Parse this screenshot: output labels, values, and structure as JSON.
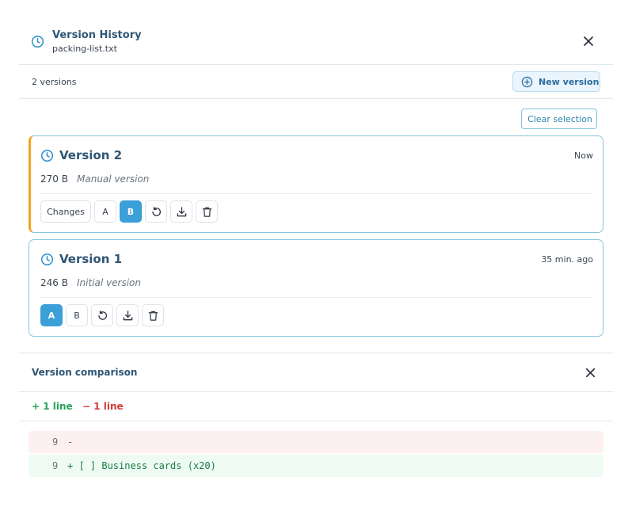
{
  "header": {
    "title": "Version History",
    "filename": "packing-list.txt",
    "accent": "#2f8fcf"
  },
  "toolbar": {
    "count_label": "2 versions",
    "new_version_label": "New version"
  },
  "clear_selection_label": "Clear selection",
  "versions": [
    {
      "title": "Version 2",
      "time": "Now",
      "size": "270 B",
      "note": "Manual version",
      "changes_label": "Changes",
      "compare_a_label": "A",
      "compare_b_label": "B",
      "selected_slot": "B",
      "is_current": true,
      "current_color": "#f0a51c"
    },
    {
      "title": "Version 1",
      "time": "35 min. ago",
      "size": "246 B",
      "note": "Initial version",
      "compare_a_label": "A",
      "compare_b_label": "B",
      "selected_slot": "A",
      "is_current": false
    }
  ],
  "comparison": {
    "title": "Version comparison",
    "added_label": "+ 1 line",
    "removed_label": "− 1 line",
    "added_color": "#27a35a",
    "removed_color": "#d93a3a",
    "lines": [
      {
        "type": "removed",
        "line_no": "9",
        "text": "- "
      },
      {
        "type": "added",
        "line_no": "9",
        "text": "+ [ ] Business cards (x20)"
      }
    ]
  },
  "icons": {
    "history": "clock-icon",
    "close": "close-icon",
    "new_version": "plus-circle-icon",
    "restore": "restore-icon",
    "download": "download-icon",
    "delete": "trash-icon"
  }
}
